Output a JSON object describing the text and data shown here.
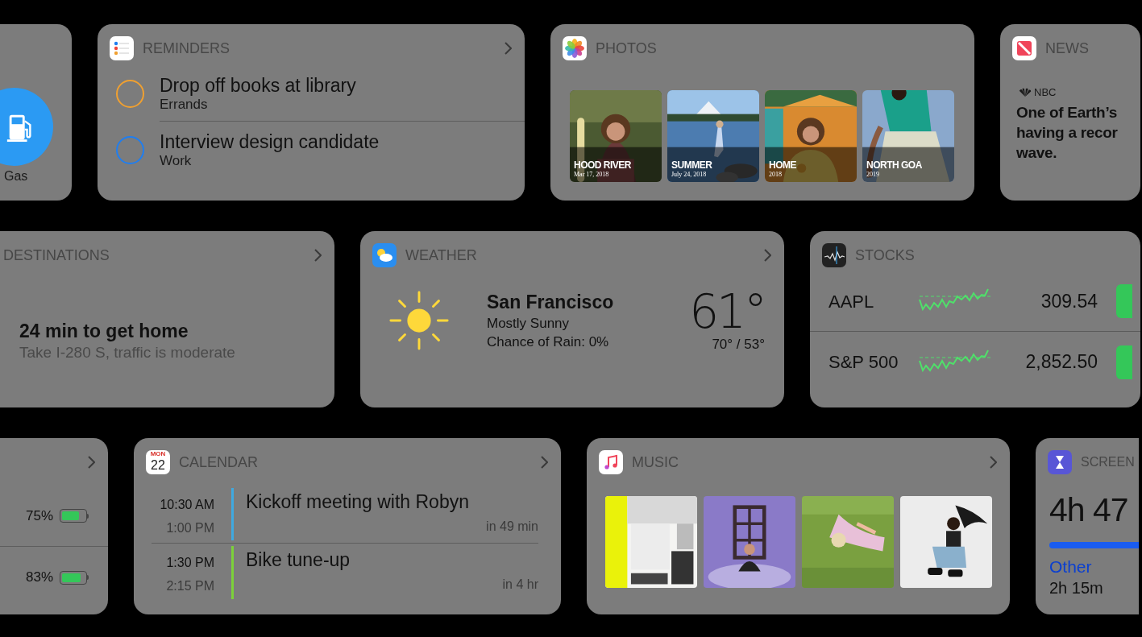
{
  "rows": [
    {
      "widgets": [
        {
          "kind": "shortcut",
          "label": "Gas"
        },
        {
          "kind": "reminders",
          "title": "REMINDERS",
          "items": [
            {
              "title": "Drop off books at library",
              "list": "Errands",
              "color": "#f0a030"
            },
            {
              "title": "Interview design candidate",
              "list": "Work",
              "color": "#1f7ef0"
            }
          ]
        },
        {
          "kind": "photos",
          "title": "PHOTOS",
          "items": [
            {
              "caption": "HOOD RIVER",
              "date": "Mar 17, 2018"
            },
            {
              "caption": "SUMMER",
              "date": "July 24, 2018"
            },
            {
              "caption": "HOME",
              "date": "2018"
            },
            {
              "caption": "NORTH GOA",
              "date": "2019"
            }
          ]
        },
        {
          "kind": "news",
          "title": "NEWS",
          "source": "NBC",
          "headline_lines": [
            "One of Earth’s",
            "having a recor",
            "wave."
          ]
        }
      ]
    },
    {
      "widgets": [
        {
          "kind": "destinations",
          "title": "DESTINATIONS",
          "eta": "24 min to get home",
          "detail": "Take I-280 S, traffic is moderate"
        },
        {
          "kind": "weather",
          "title": "WEATHER",
          "city": "San Francisco",
          "condition": "Mostly Sunny",
          "rain": "Chance of Rain: 0%",
          "temp": "61°",
          "range": "70° / 53°"
        },
        {
          "kind": "stocks",
          "title": "STOCKS",
          "items": [
            {
              "symbol": "AAPL",
              "price": "309.54"
            },
            {
              "symbol": "S&P 500",
              "price": "2,852.50"
            }
          ]
        }
      ]
    },
    {
      "widgets": [
        {
          "kind": "batteries",
          "items": [
            {
              "percent": "75%",
              "level": 0.75
            },
            {
              "percent": "83%",
              "level": 0.83
            }
          ]
        },
        {
          "kind": "calendar",
          "title": "CALENDAR",
          "icon_day": "MON",
          "icon_date": "22",
          "events": [
            {
              "start": "10:30 AM",
              "end": "1:00 PM",
              "title": "Kickoff meeting with Robyn",
              "relative": "in 49 min",
              "color": "#3fa9e0"
            },
            {
              "start": "1:30 PM",
              "end": "2:15 PM",
              "title": "Bike tune-up",
              "relative": "in 4 hr",
              "color": "#7cd13a"
            }
          ]
        },
        {
          "kind": "music",
          "title": "MUSIC"
        },
        {
          "kind": "screen_time",
          "title": "SCREEN",
          "total": "4h 47",
          "category": "Other",
          "category_time": "2h 15m"
        }
      ]
    }
  ]
}
